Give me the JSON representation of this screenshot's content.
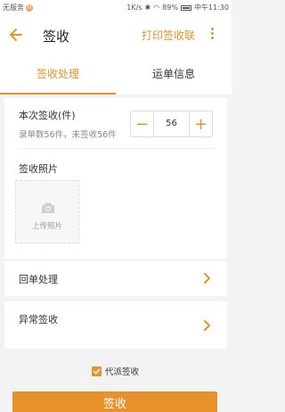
{
  "status_bar": {
    "carrier": "无服务",
    "carrier_badge": "H",
    "speed": "1K/s",
    "battery": "89%",
    "time": "中午11:30"
  },
  "header": {
    "title": "签收",
    "action": "打印签收联"
  },
  "tabs": [
    {
      "label": "签收处理",
      "active": true
    },
    {
      "label": "运单信息",
      "active": false
    }
  ],
  "sign_form": {
    "count_label": "本次签收(件)",
    "count_summary": "录单数56件，未签收56件",
    "minus": "−",
    "plus": "+",
    "count_value": "56",
    "photo_label": "签收照片",
    "upload_text": "上传照片"
  },
  "rows": {
    "return_label": "回单处理",
    "exception_label": "异常签收"
  },
  "proxy": {
    "label": "代派签收",
    "checked": true
  },
  "submit": {
    "label": "签收"
  },
  "colors": {
    "accent": "#e8912b"
  }
}
